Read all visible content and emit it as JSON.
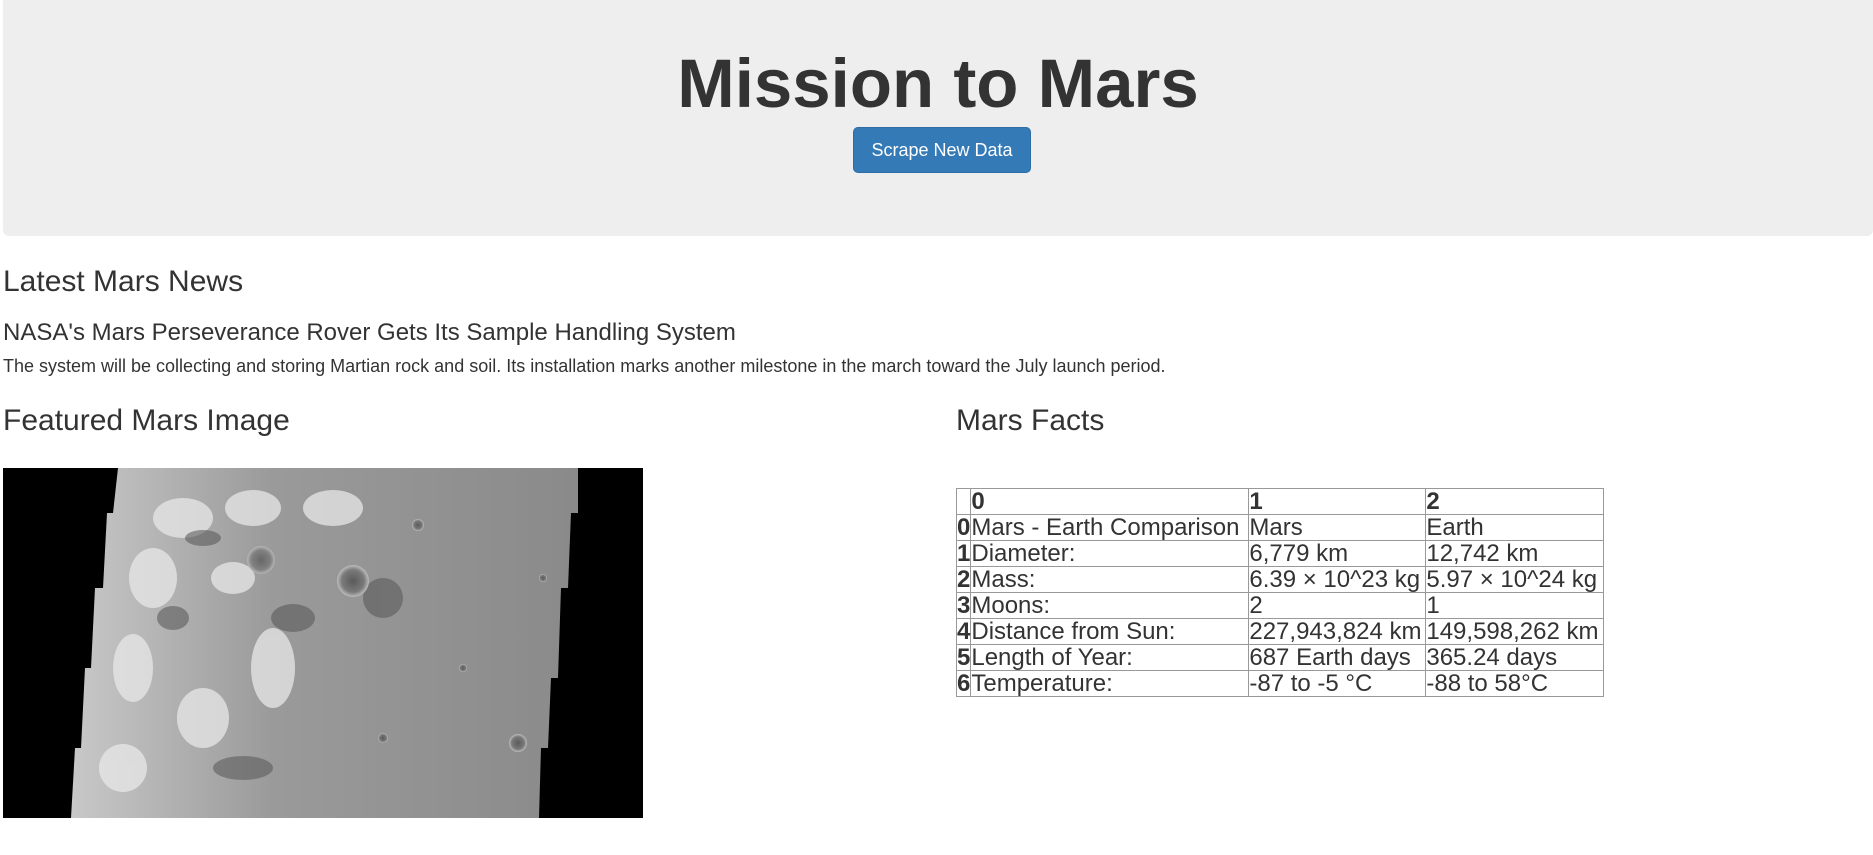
{
  "header": {
    "title": "Mission to Mars",
    "scrape_button_label": "Scrape New Data"
  },
  "news": {
    "section_title": "Latest Mars News",
    "headline": "NASA's Mars Perseverance Rover Gets Its Sample Handling System",
    "teaser": "The system will be collecting and storing Martian rock and soil. Its installation marks another milestone in the march toward the July launch period."
  },
  "featured_image": {
    "section_title": "Featured Mars Image"
  },
  "facts": {
    "section_title": "Mars Facts",
    "columns": [
      "",
      "0",
      "1",
      "2"
    ],
    "rows": [
      [
        "0",
        "Mars - Earth Comparison",
        "Mars",
        "Earth"
      ],
      [
        "1",
        "Diameter:",
        "6,779 km",
        "12,742 km"
      ],
      [
        "2",
        "Mass:",
        "6.39 × 10^23 kg",
        "5.97 × 10^24 kg"
      ],
      [
        "3",
        "Moons:",
        "2",
        "1"
      ],
      [
        "4",
        "Distance from Sun:",
        "227,943,824 km",
        "149,598,262 km"
      ],
      [
        "5",
        "Length of Year:",
        "687 Earth days",
        "365.24 days"
      ],
      [
        "6",
        "Temperature:",
        "-87 to -5 °C",
        "-88 to 58°C"
      ]
    ]
  }
}
